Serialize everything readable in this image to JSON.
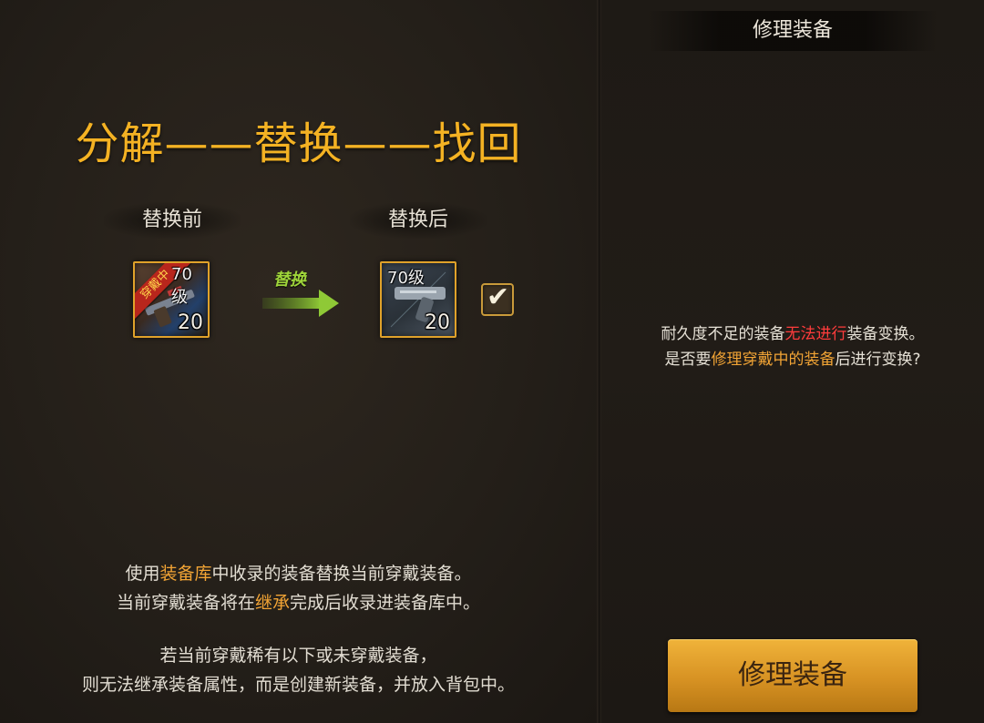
{
  "left": {
    "title": "分解——替换——找回",
    "before_label": "替换前",
    "after_label": "替换后",
    "arrow_label": "替换",
    "before_item": {
      "level_text": "70级",
      "equipped_badge": "穿戴中",
      "count": "20",
      "icon": "rifle-weapon-icon"
    },
    "after_item": {
      "level_text": "70级",
      "count": "20",
      "icon": "pistol-weapon-icon"
    },
    "checkbox": {
      "checked": true
    },
    "info1": {
      "l1a": "使用",
      "l1b": "装备库",
      "l1c": "中收录的装备替换当前穿戴装备。",
      "l2a": "当前穿戴装备将在",
      "l2b": "继承",
      "l2c": "完成后收录进装备库中。"
    },
    "info2": {
      "l1": "若当前穿戴稀有以下或未穿戴装备，",
      "l2": "则无法继承装备属性，而是创建新装备，并放入背包中。"
    }
  },
  "right": {
    "title": "修理装备",
    "notice": {
      "l1a": "耐久度不足的装备",
      "l1b": "无法进行",
      "l1c": "装备变换。",
      "l2a": "是否要",
      "l2b": "修理穿戴中的装备",
      "l2c": "后进行变换?"
    },
    "button_label": "修理装备"
  },
  "colors": {
    "title_gold": "#f4b223",
    "highlight_orange": "#f2a435",
    "warning_red": "#ff3c3c",
    "button_gold": "#d79223"
  }
}
